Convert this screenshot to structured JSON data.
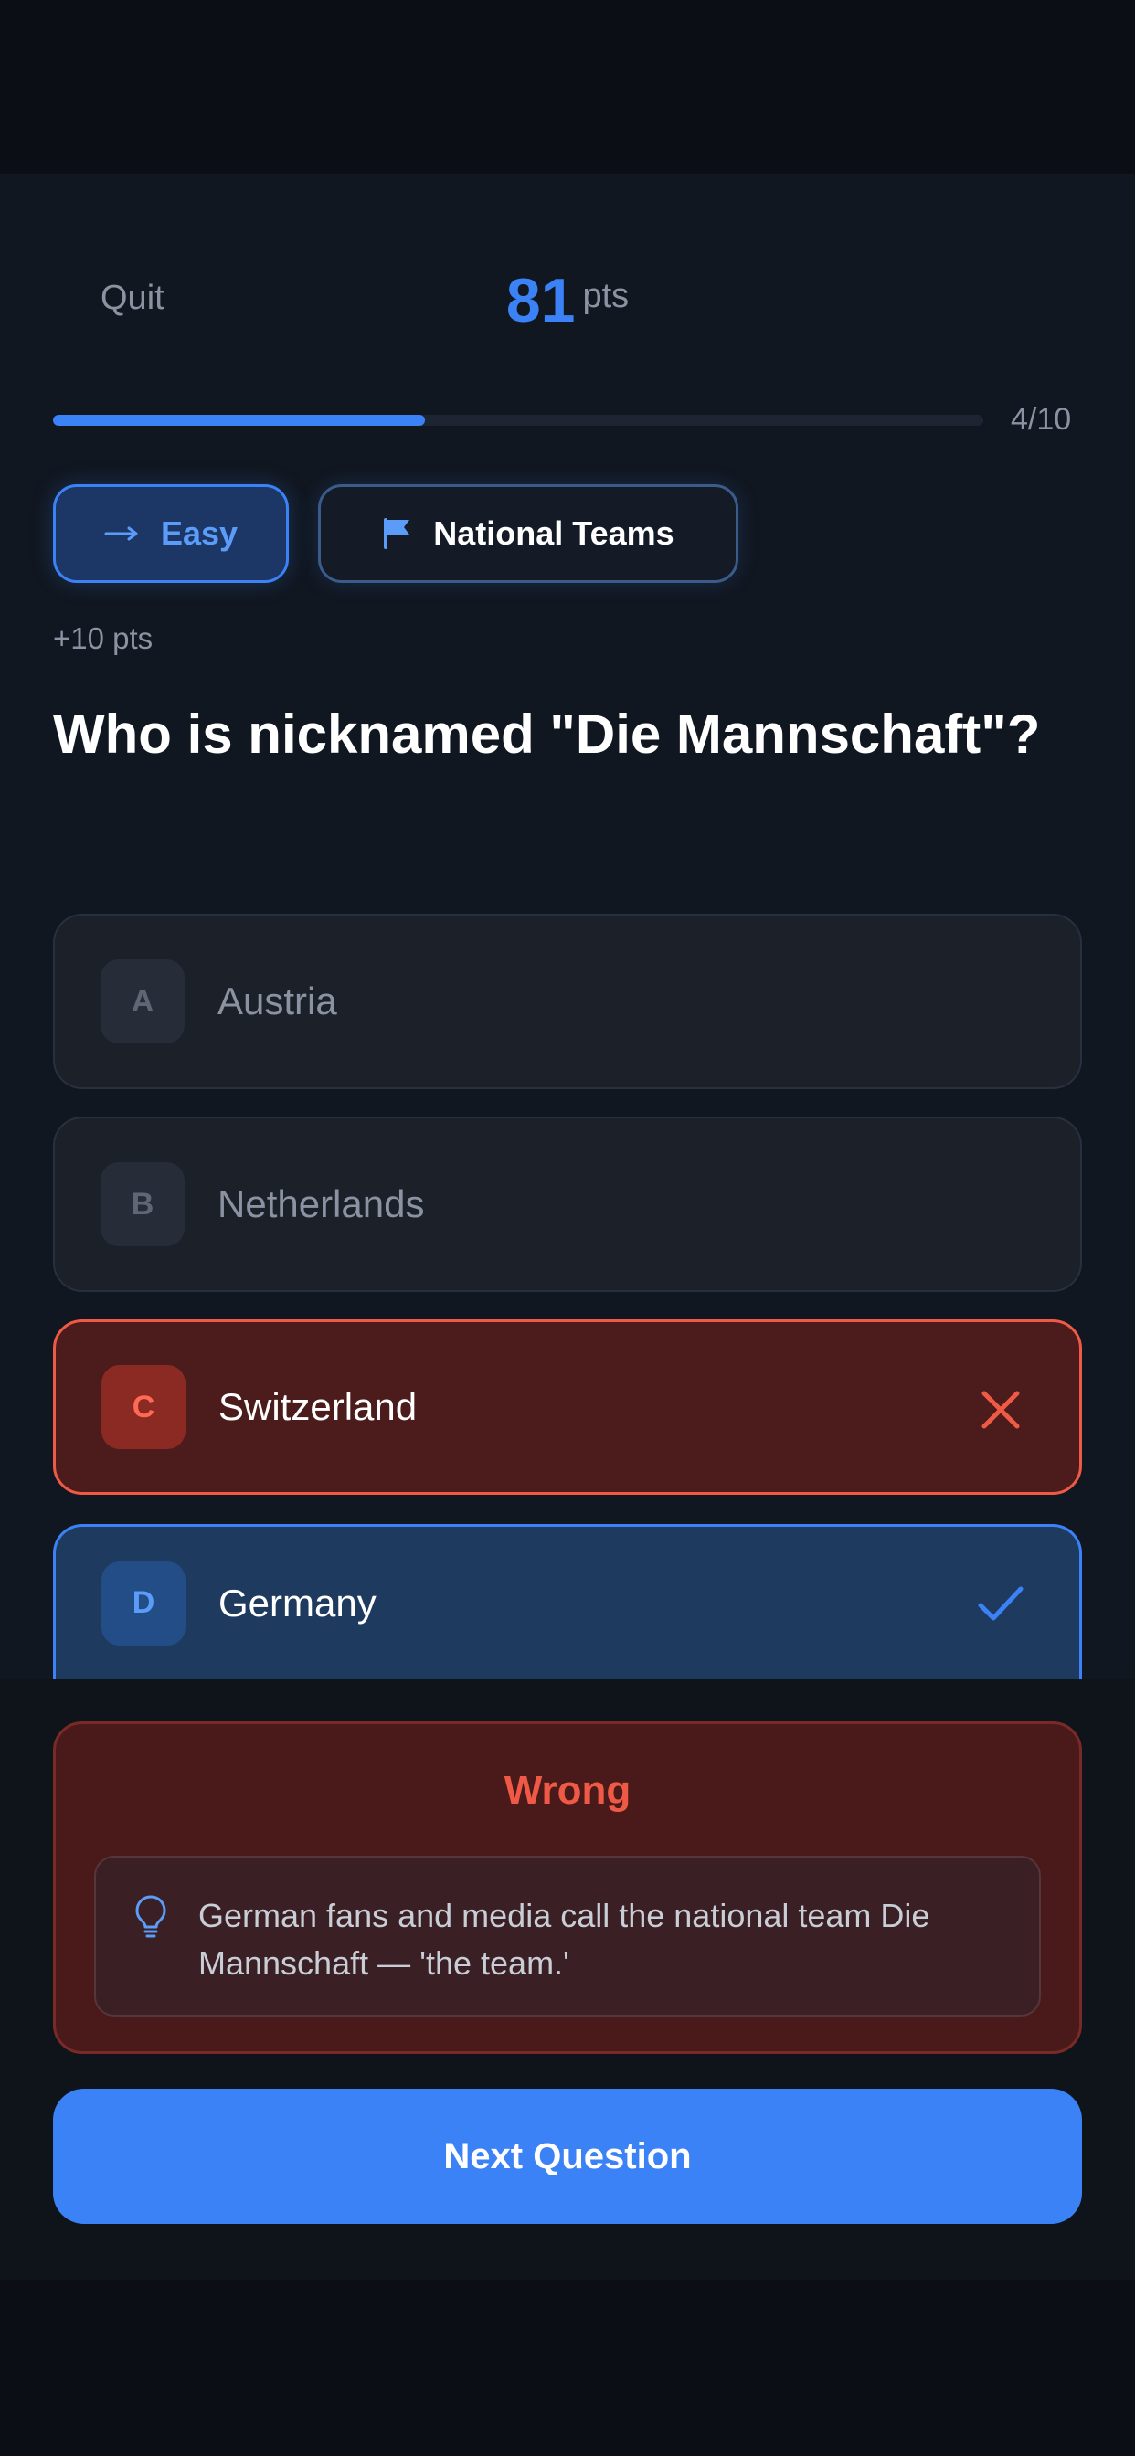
{
  "header": {
    "quit_label": "Quit",
    "score_value": "81",
    "score_unit": "pts"
  },
  "progress": {
    "current": 4,
    "total": 10,
    "fraction": 0.4,
    "label": "4/10"
  },
  "chips": {
    "difficulty": "Easy",
    "category": "National Teams"
  },
  "points_gain": "+10 pts",
  "question": "Who is nicknamed \"Die Mannschaft\"?",
  "options": [
    {
      "letter": "A",
      "label": "Austria",
      "state": "neutral"
    },
    {
      "letter": "B",
      "label": "Netherlands",
      "state": "neutral"
    },
    {
      "letter": "C",
      "label": "Switzerland",
      "state": "wrong"
    },
    {
      "letter": "D",
      "label": "Germany",
      "state": "correct"
    }
  ],
  "feedback": {
    "title": "Wrong",
    "explanation": "German fans and media call the national team Die Mannschaft — 'the team.'"
  },
  "next_button": "Next Question",
  "colors": {
    "accent": "#3b82f6",
    "wrong": "#ef5a46",
    "background": "#111720"
  },
  "icons": {
    "difficulty": "arrow-right-icon",
    "category": "flag-icon",
    "wrong": "close-icon",
    "correct": "check-icon",
    "hint": "lightbulb-icon"
  }
}
